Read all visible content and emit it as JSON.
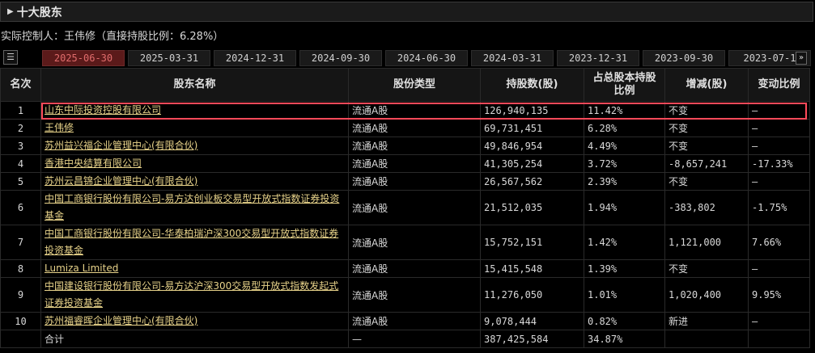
{
  "section": {
    "title": "十大股东"
  },
  "controller": {
    "text": "实际控制人：王伟修（直接持股比例：6.28%）"
  },
  "tabs": [
    {
      "label": "2025-06-30",
      "active": true
    },
    {
      "label": "2025-03-31"
    },
    {
      "label": "2024-12-31"
    },
    {
      "label": "2024-09-30"
    },
    {
      "label": "2024-06-30"
    },
    {
      "label": "2024-03-31"
    },
    {
      "label": "2023-12-31"
    },
    {
      "label": "2023-09-30"
    },
    {
      "label": "2023-07-1"
    }
  ],
  "table": {
    "headers": {
      "rank": "名次",
      "name": "股东名称",
      "type": "股份类型",
      "shares": "持股数(股)",
      "ratio": "占总股本持股比例",
      "change": "增减(股)",
      "change_ratio": "变动比例"
    },
    "rows": [
      {
        "rank": "1",
        "name": "山东中际投资控股有限公司",
        "type": "流通A股",
        "shares": "126,940,135",
        "ratio": "11.42%",
        "change": "不变",
        "change_ratio": "—"
      },
      {
        "rank": "2",
        "name": "王伟修",
        "type": "流通A股",
        "shares": "69,731,451",
        "ratio": "6.28%",
        "change": "不变",
        "change_ratio": "—"
      },
      {
        "rank": "3",
        "name": "苏州益兴福企业管理中心(有限合伙)",
        "type": "流通A股",
        "shares": "49,846,954",
        "ratio": "4.49%",
        "change": "不变",
        "change_ratio": "—"
      },
      {
        "rank": "4",
        "name": "香港中央结算有限公司",
        "type": "流通A股",
        "shares": "41,305,254",
        "ratio": "3.72%",
        "change": "-8,657,241",
        "change_ratio": "-17.33%"
      },
      {
        "rank": "5",
        "name": "苏州云昌锦企业管理中心(有限合伙)",
        "type": "流通A股",
        "shares": "26,567,562",
        "ratio": "2.39%",
        "change": "不变",
        "change_ratio": "—"
      },
      {
        "rank": "6",
        "name": "中国工商银行股份有限公司-易方达创业板交易型开放式指数证券投资基金",
        "type": "流通A股",
        "shares": "21,512,035",
        "ratio": "1.94%",
        "change": "-383,802",
        "change_ratio": "-1.75%"
      },
      {
        "rank": "7",
        "name": "中国工商银行股份有限公司-华泰柏瑞沪深300交易型开放式指数证券投资基金",
        "type": "流通A股",
        "shares": "15,752,151",
        "ratio": "1.42%",
        "change": "1,121,000",
        "change_ratio": "7.66%"
      },
      {
        "rank": "8",
        "name": "Lumiza Limited",
        "type": "流通A股",
        "shares": "15,415,548",
        "ratio": "1.39%",
        "change": "不变",
        "change_ratio": "—"
      },
      {
        "rank": "9",
        "name": "中国建设银行股份有限公司-易方达沪深300交易型开放式指数发起式证券投资基金",
        "type": "流通A股",
        "shares": "11,276,050",
        "ratio": "1.01%",
        "change": "1,020,400",
        "change_ratio": "9.95%"
      },
      {
        "rank": "10",
        "name": "苏州福睿晖企业管理中心(有限合伙)",
        "type": "流通A股",
        "shares": "9,078,444",
        "ratio": "0.82%",
        "change": "新进",
        "change_ratio": "—"
      }
    ],
    "total": {
      "label": "合计",
      "type": "—",
      "shares": "387,425,584",
      "ratio": "34.87%",
      "change": "",
      "change_ratio": ""
    }
  },
  "colors": {
    "positive": "#ff4a4a",
    "negative": "#3ecf3e",
    "link": "#e8d38a",
    "highlight": "#ff4a5a",
    "active_tab": "#5b1a1a"
  },
  "icons": {
    "header": "triangle-right-icon",
    "menu": "list-menu-icon",
    "next": "double-chevron-right-icon"
  }
}
